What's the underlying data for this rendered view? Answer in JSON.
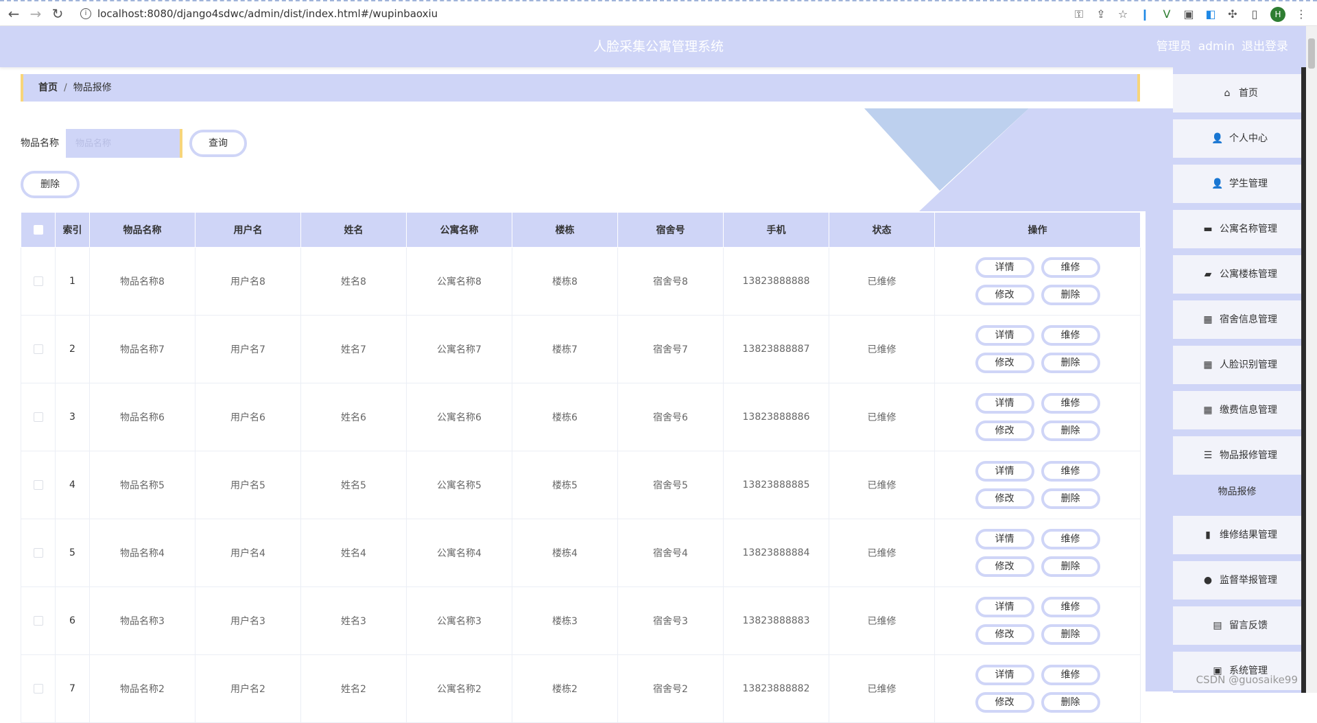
{
  "browser": {
    "url": "localhost:8080/django4sdwc/admin/dist/index.html#/wupinbaoxiu",
    "profile_initial": "H"
  },
  "header": {
    "title": "人脸采集公寓管理系统",
    "role": "管理员",
    "user": "admin",
    "logout": "退出登录"
  },
  "breadcrumb": {
    "home": "首页",
    "separator": "/",
    "current": "物品报修"
  },
  "search": {
    "label": "物品名称",
    "placeholder": "物品名称",
    "button": "查询"
  },
  "actions": {
    "delete": "删除"
  },
  "table": {
    "columns": [
      "索引",
      "物品名称",
      "用户名",
      "姓名",
      "公寓名称",
      "楼栋",
      "宿舍号",
      "手机",
      "状态",
      "操作"
    ],
    "op_labels": {
      "detail": "详情",
      "repair": "维修",
      "edit": "修改",
      "delete": "删除"
    },
    "rows": [
      {
        "index": "1",
        "item": "物品名称8",
        "username": "用户名8",
        "name": "姓名8",
        "apartment": "公寓名称8",
        "building": "楼栋8",
        "room": "宿舍号8",
        "phone": "13823888888",
        "status": "已维修"
      },
      {
        "index": "2",
        "item": "物品名称7",
        "username": "用户名7",
        "name": "姓名7",
        "apartment": "公寓名称7",
        "building": "楼栋7",
        "room": "宿舍号7",
        "phone": "13823888887",
        "status": "已维修"
      },
      {
        "index": "3",
        "item": "物品名称6",
        "username": "用户名6",
        "name": "姓名6",
        "apartment": "公寓名称6",
        "building": "楼栋6",
        "room": "宿舍号6",
        "phone": "13823888886",
        "status": "已维修"
      },
      {
        "index": "4",
        "item": "物品名称5",
        "username": "用户名5",
        "name": "姓名5",
        "apartment": "公寓名称5",
        "building": "楼栋5",
        "room": "宿舍号5",
        "phone": "13823888885",
        "status": "已维修"
      },
      {
        "index": "5",
        "item": "物品名称4",
        "username": "用户名4",
        "name": "姓名4",
        "apartment": "公寓名称4",
        "building": "楼栋4",
        "room": "宿舍号4",
        "phone": "13823888884",
        "status": "已维修"
      },
      {
        "index": "6",
        "item": "物品名称3",
        "username": "用户名3",
        "name": "姓名3",
        "apartment": "公寓名称3",
        "building": "楼栋3",
        "room": "宿舍号3",
        "phone": "13823888883",
        "status": "已维修"
      },
      {
        "index": "7",
        "item": "物品名称2",
        "username": "用户名2",
        "name": "姓名2",
        "apartment": "公寓名称2",
        "building": "楼栋2",
        "room": "宿舍号2",
        "phone": "13823888882",
        "status": "已维修"
      }
    ]
  },
  "sidebar": {
    "items": [
      {
        "label": "首页",
        "icon": "home-icon"
      },
      {
        "label": "个人中心",
        "icon": "user-icon"
      },
      {
        "label": "学生管理",
        "icon": "user-icon"
      },
      {
        "label": "公寓名称管理",
        "icon": "chat-icon"
      },
      {
        "label": "公寓楼栋管理",
        "icon": "briefcase-icon"
      },
      {
        "label": "宿舍信息管理",
        "icon": "grid-icon"
      },
      {
        "label": "人脸识别管理",
        "icon": "grid-icon"
      },
      {
        "label": "缴费信息管理",
        "icon": "grid-icon"
      },
      {
        "label": "物品报修管理",
        "icon": "sliders-icon"
      },
      {
        "label": "维修结果管理",
        "icon": "chart-icon"
      },
      {
        "label": "监督举报管理",
        "icon": "balloon-icon"
      },
      {
        "label": "留言反馈",
        "icon": "clipboard-icon"
      },
      {
        "label": "系统管理",
        "icon": "check-icon"
      }
    ],
    "active_submenu": "物品报修"
  },
  "watermark": "CSDN @guosaike99",
  "colors": {
    "accent": "#cfd5f7",
    "border_accent": "#f7d57a",
    "sidebar_edge": "#2b2b2b"
  }
}
